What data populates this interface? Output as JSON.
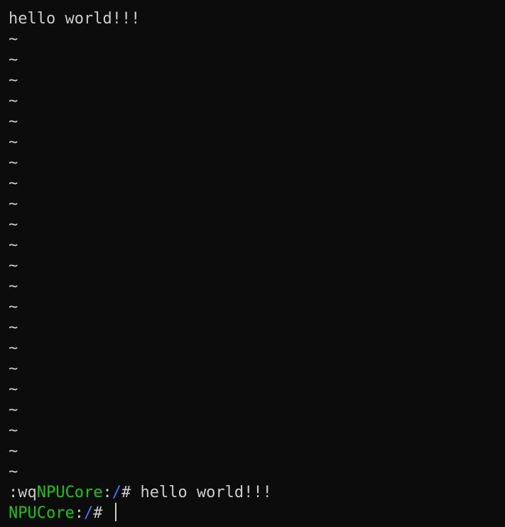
{
  "editor": {
    "buffer_line": "hello world!!!",
    "empty_line_marker": "~",
    "empty_line_count": 22
  },
  "command_line": {
    "command": ":wq"
  },
  "shell": {
    "prompt_host": "NPUCore",
    "prompt_sep": ":",
    "prompt_path": "/",
    "prompt_symbol": "# ",
    "output_line": "hello world!!!"
  },
  "colors": {
    "background": "#0c0c0c",
    "foreground": "#cccccc",
    "host": "#16c60c",
    "path": "#3b78ff"
  }
}
